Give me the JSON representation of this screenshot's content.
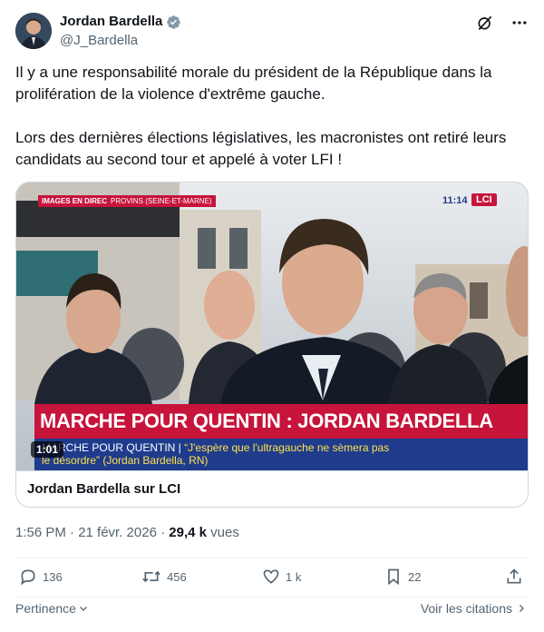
{
  "author": {
    "name": "Jordan Bardella",
    "handle": "@J_Bardella"
  },
  "tweet": {
    "paragraphs": [
      "Il y a une responsabilité morale du président de la République dans la prolifération de la violence d'extrême gauche.",
      "Lors des dernières élections législatives, les macronistes ont retiré leurs candidats au second tour et appelé à voter LFI !"
    ]
  },
  "media": {
    "overlay_direct": "IMAGES EN DIRECT",
    "overlay_place": "PROVINS (SEINE-ET-MARNE)",
    "overlay_time": "11:14",
    "channel": "LCI",
    "banner": "MARCHE POUR QUENTIN : JORDAN BARDELLA S'EXPRIME",
    "ticker_prefix": "MARCHE POUR QUENTIN |",
    "ticker_quote": "“J'espère que l'ultragauche ne sèmera pas",
    "ticker_line2": "le désordre” (Jordan Bardella, RN)",
    "duration": "1:01",
    "card_title": "Jordan Bardella sur LCI"
  },
  "meta": {
    "time": "1:56 PM · 21 févr. 2026 · ",
    "views_count": "29,4 k",
    "views_label": " vues"
  },
  "actions": {
    "replies": "136",
    "reposts": "456",
    "likes": "1 k",
    "bookmarks": "22"
  },
  "footer": {
    "sort_label": "Pertinence",
    "citations_label": "Voir les citations"
  },
  "colors": {
    "verified": "#829aab",
    "lci_red": "#c7143b",
    "ticker_blue": "#1f3c8c"
  }
}
